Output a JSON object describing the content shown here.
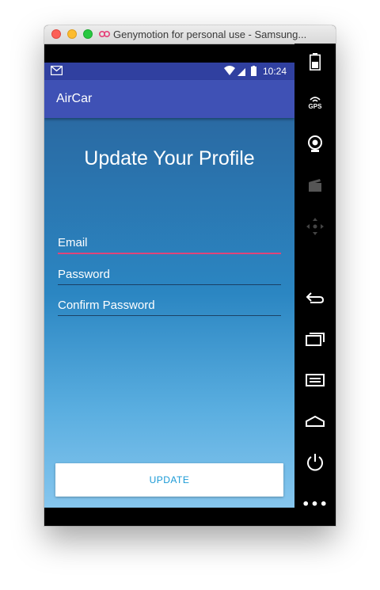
{
  "window": {
    "title": "Genymotion for personal use - Samsung..."
  },
  "status_bar": {
    "time": "10:24"
  },
  "app": {
    "title": "AirCar",
    "heading": "Update Your Profile"
  },
  "form": {
    "email_placeholder": "Email",
    "password_placeholder": "Password",
    "confirm_placeholder": "Confirm Password",
    "update_label": "UPDATE"
  },
  "sidebar": {
    "gps_label": "GPS",
    "more_label": "•••"
  },
  "colors": {
    "status_bar": "#3040a0",
    "app_bar": "#3f51b5",
    "accent": "#e0457a",
    "button_text": "#1a9ad6"
  }
}
